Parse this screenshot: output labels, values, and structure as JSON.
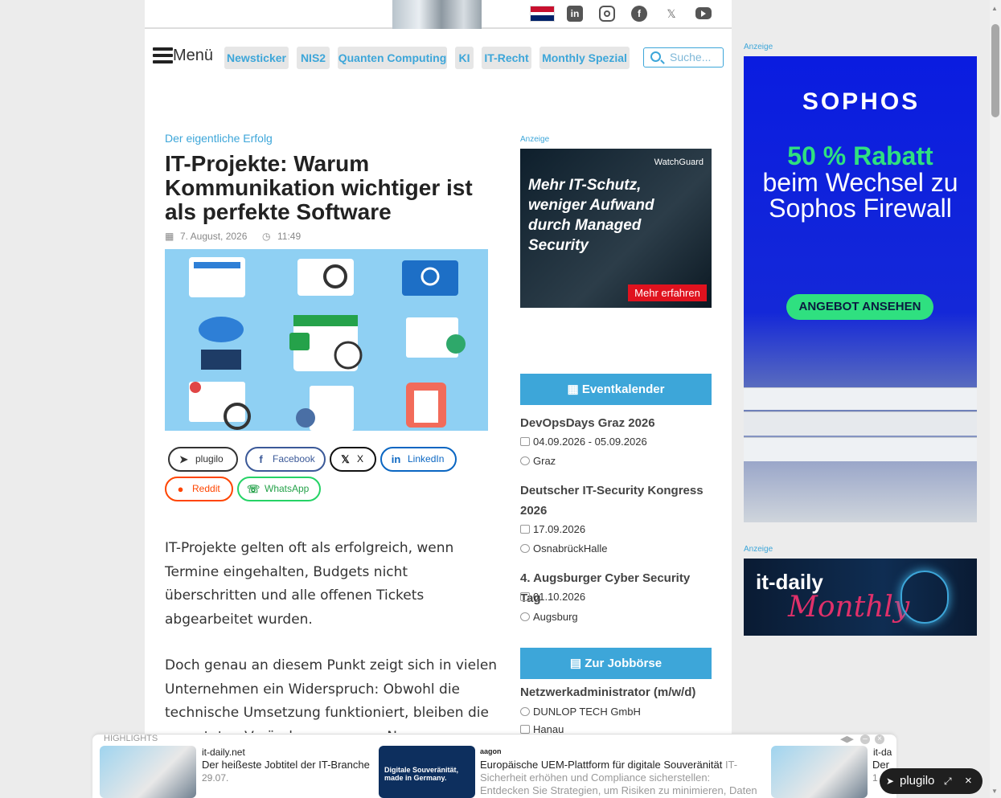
{
  "nav": {
    "menu_label": "Menü",
    "tags": [
      "Newsticker",
      "NIS2",
      "Quanten Computing",
      "KI",
      "IT-Recht",
      "Monthly Spezial"
    ],
    "search_placeholder": "Suche..."
  },
  "article": {
    "kicker": "Der eigentliche Erfolg",
    "title": "IT-Projekte: Warum Kommunikation wichtiger ist als perfekte Software",
    "date": "7. August, 2026",
    "time": "11:49",
    "share": [
      "plugilo",
      "Facebook",
      "X",
      "LinkedIn",
      "Reddit",
      "WhatsApp"
    ],
    "paragraphs": [
      "IT-Projekte gelten oft als erfolgreich, wenn Termine eingehalten, Budgets nicht überschritten und alle offenen Tickets abgearbeitet wurden.",
      "Doch genau an diesem Punkt zeigt sich in vielen Unternehmen ein Widerspruch: Obwohl die technische Umsetzung funktioniert, bleiben die erwarteten Veränderungen aus. N"
    ]
  },
  "ads": {
    "label": "Anzeige",
    "watchguard": {
      "brand": "WatchGuard",
      "text": "Mehr IT-Schutz, weniger Aufwand durch Managed Security",
      "button": "Mehr erfahren"
    },
    "sophos": {
      "brand": "SOPHOS",
      "headline": "50 % Rabatt",
      "subline": "beim Wechsel zu Sophos Firewall",
      "button": "ANGEBOT ANSEHEN"
    },
    "itdaily": {
      "brand": "it-daily",
      "sub": "Monthly"
    }
  },
  "events": {
    "button": "Eventkalender",
    "items": [
      {
        "title": "DevOpsDays Graz 2026",
        "date": "04.09.2026 - 05.09.2026",
        "place": "Graz"
      },
      {
        "title": "Deutscher IT-Security Kongress 2026",
        "date": "17.09.2026",
        "place": "OsnabrückHalle"
      },
      {
        "title": "4. Augsburger Cyber Security Tag",
        "date": "01.10.2026",
        "place": "Augsburg"
      }
    ]
  },
  "jobs": {
    "button": "Zur Jobbörse",
    "items": [
      {
        "title": "Netzwerkadministrator (m/w/d)",
        "company": "DUNLOP TECH GmbH",
        "place": "Hanau"
      }
    ]
  },
  "highlights": {
    "label": "HIGHLIGHTS",
    "cards": [
      {
        "brand": "it-daily.net",
        "title": "Der heißeste Jobtitel der IT-Branche",
        "date": "29.07."
      },
      {
        "brand": "aagon",
        "img_text": "Digitale Souveränität, made in Germany.",
        "title": "Europäische UEM-Plattform für digitale Souveränität",
        "tag": "IT-",
        "desc": "Sicherheit erhöhen und Compliance sicherstellen: Entdecken Sie Strategien, um Risiken zu minimieren, Daten"
      },
      {
        "brand": "it-da",
        "title": "Der",
        "date": "1"
      }
    ],
    "plugilo_pill": "plugilo"
  }
}
